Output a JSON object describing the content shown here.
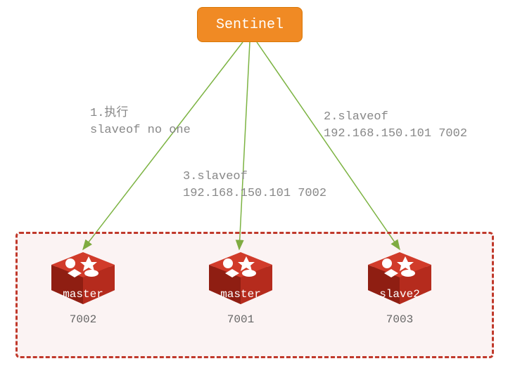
{
  "sentinel": {
    "label": "Sentinel"
  },
  "edges": {
    "left": {
      "line1": "1.执行",
      "line2": "slaveof no one"
    },
    "middle": {
      "line1": "3.slaveof",
      "line2": "192.168.150.101 7002"
    },
    "right": {
      "line1": "2.slaveof",
      "line2": "192.168.150.101 7002"
    }
  },
  "nodes": {
    "n1": {
      "role": "master",
      "port": "7002"
    },
    "n2": {
      "role": "master",
      "port": "7001"
    },
    "n3": {
      "role": "slave2",
      "port": "7003"
    }
  },
  "colors": {
    "sentinel_bg": "#f08a24",
    "arrow": "#7cb342",
    "redis": "#c0392b",
    "cluster_border": "#c0392b"
  }
}
